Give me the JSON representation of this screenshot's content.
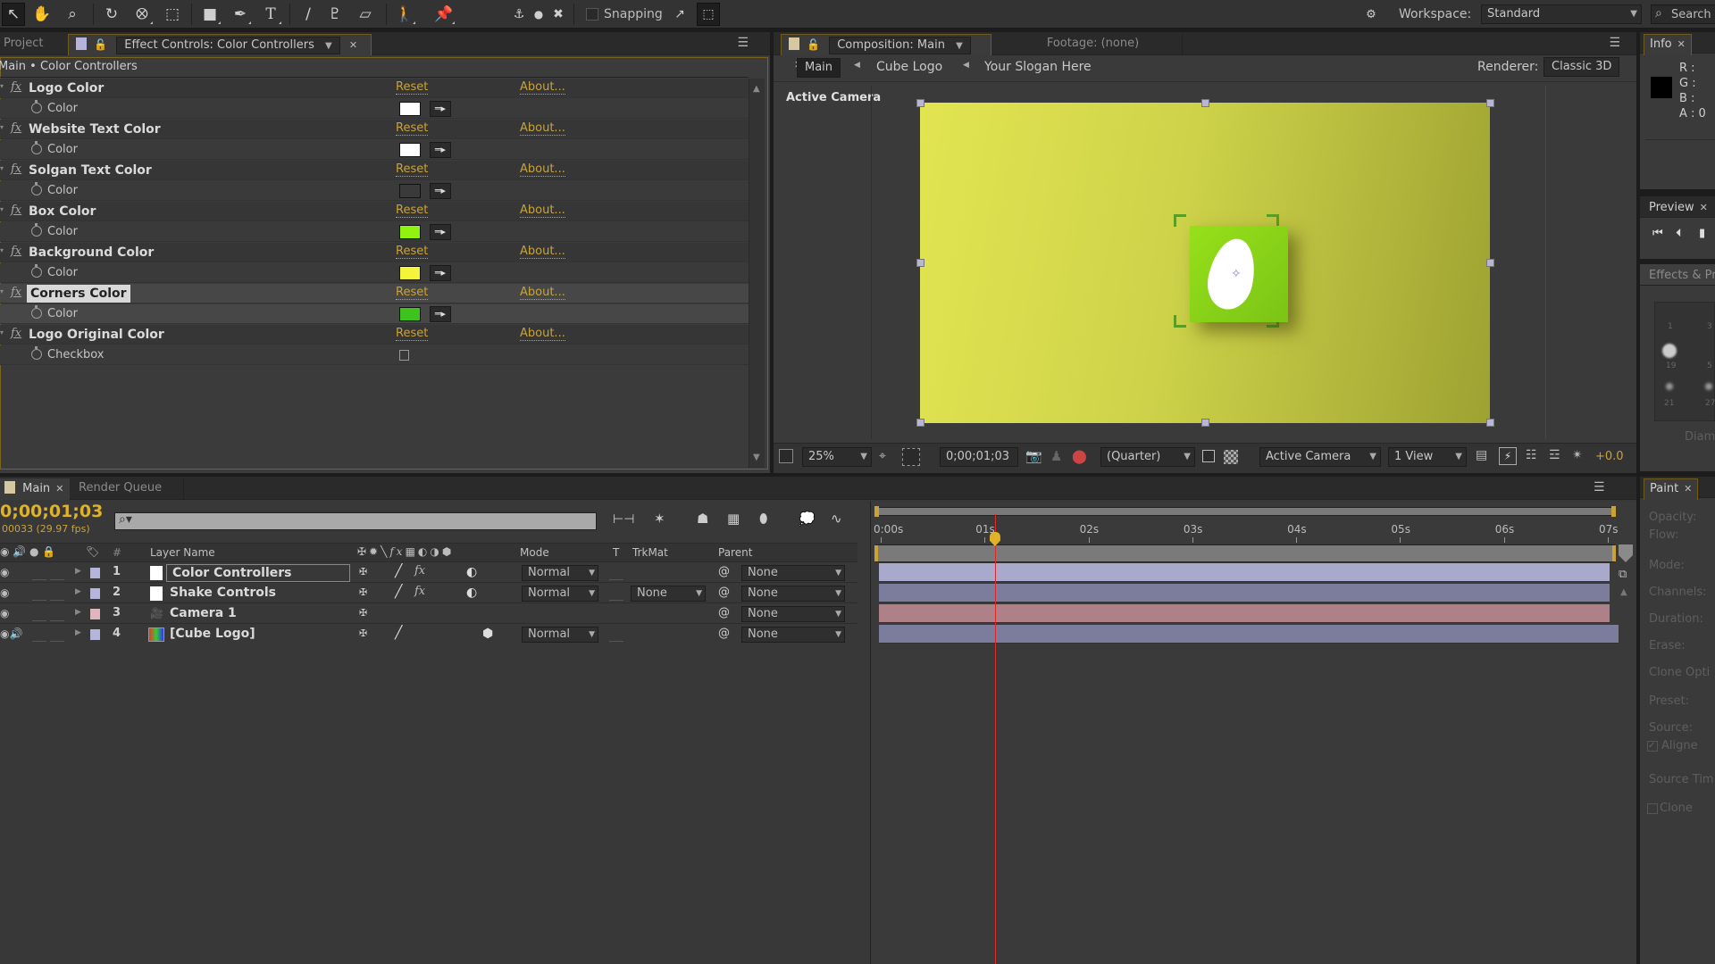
{
  "toolbar": {
    "tools": [
      "selection-tool",
      "hand-tool",
      "zoom-tool",
      "rotation-tool",
      "orbit-camera-tool",
      "pan-behind-tool",
      "rectangle-tool",
      "pen-tool",
      "type-tool",
      "brush-tool",
      "clone-stamp-tool",
      "eraser-tool",
      "roto-brush-tool",
      "puppet-pin-tool"
    ],
    "snapping_label": "Snapping",
    "workspace_label": "Workspace:",
    "workspace_value": "Standard",
    "search_placeholder": "Search Help"
  },
  "effect_controls": {
    "project_tab": "Project",
    "tab_label": "Effect Controls: Color Controllers",
    "breadcrumb": "Main • Color Controllers",
    "reset_label": "Reset",
    "about_label": "About...",
    "effects": [
      {
        "name": "Logo Color",
        "prop": "Color",
        "type": "color",
        "value": "#ffffff"
      },
      {
        "name": "Website Text Color",
        "prop": "Color",
        "type": "color",
        "value": "#ffffff"
      },
      {
        "name": "Solgan Text Color",
        "prop": "Color",
        "type": "color",
        "value": "#3a3a3a"
      },
      {
        "name": "Box Color",
        "prop": "Color",
        "type": "color",
        "value": "#8ff20f"
      },
      {
        "name": "Background Color",
        "prop": "Color",
        "type": "color",
        "value": "#f4f43a"
      },
      {
        "name": "Corners Color",
        "prop": "Color",
        "type": "color",
        "value": "#3ec21e",
        "selected": true
      },
      {
        "name": "Logo Original Color",
        "prop": "Checkbox",
        "type": "checkbox",
        "value": false
      }
    ]
  },
  "composition": {
    "tab_label": "Composition: Main",
    "footage_tab": "Footage: (none)",
    "nav": [
      "Main",
      "Cube Logo",
      "Your Slogan Here"
    ],
    "renderer_label": "Renderer:",
    "renderer_value": "Classic 3D",
    "view_label": "Active Camera",
    "footer": {
      "zoom": "25%",
      "timecode": "0;00;01;03",
      "resolution": "(Quarter)",
      "camera": "Active Camera",
      "views": "1 View",
      "exposure": "+0.0"
    },
    "colors": {
      "bg_light": "#e2e551",
      "bg_dark": "#9da232",
      "box": "#8ed21a"
    }
  },
  "info_panel": {
    "title": "Info",
    "labels": [
      "R :",
      "G :",
      "B :",
      "A : 0"
    ]
  },
  "preview_panel": {
    "title": "Preview"
  },
  "effects_presets_panel": {
    "title": "Effects & Presets",
    "brush_sizes": [
      "1",
      "3",
      "19",
      "5",
      "21",
      "27"
    ],
    "diameter_label": "Diam"
  },
  "paint_panel": {
    "title": "Paint",
    "labels": [
      "Opacity:",
      "Flow:",
      "Mode:",
      "Channels:",
      "Duration:",
      "Erase:",
      "Clone Opti",
      "Preset:",
      "Source:",
      "Aligne",
      "Source Tim",
      "Clone"
    ]
  },
  "timeline": {
    "tabs": [
      "Main",
      "Render Queue"
    ],
    "timecode": "0;00;01;03",
    "frame_info": "00033 (29.97 fps)",
    "columns": {
      "layer_name": "Layer Name",
      "mode": "Mode",
      "t": "T",
      "trkmat": "TrkMat",
      "parent": "Parent",
      "hash": "#"
    },
    "ruler": [
      "0:00s",
      "01s",
      "02s",
      "03s",
      "04s",
      "05s",
      "06s",
      "07s"
    ],
    "playhead_seconds": 1.1,
    "layers": [
      {
        "num": "1",
        "name": "Color Controllers",
        "label_color": "#b4b4dc",
        "mode": "Normal",
        "trkmat": "",
        "parent": "None",
        "selected": true,
        "bar_color": "#a9a9cc"
      },
      {
        "num": "2",
        "name": "Shake Controls",
        "label_color": "#b4b4dc",
        "mode": "Normal",
        "trkmat": "None",
        "parent": "None",
        "selected": false,
        "bar_color": "#7c7c9c"
      },
      {
        "num": "3",
        "name": "Camera 1",
        "label_color": "#e2b4c0",
        "mode": "",
        "trkmat": "",
        "parent": "None",
        "selected": false,
        "bar_color": "#ae8088"
      },
      {
        "num": "4",
        "name": "[Cube Logo]",
        "label_color": "#b4b4dc",
        "mode": "Normal",
        "trkmat": "",
        "parent": "None",
        "selected": false,
        "bar_color": "#7c7c9c"
      }
    ]
  }
}
